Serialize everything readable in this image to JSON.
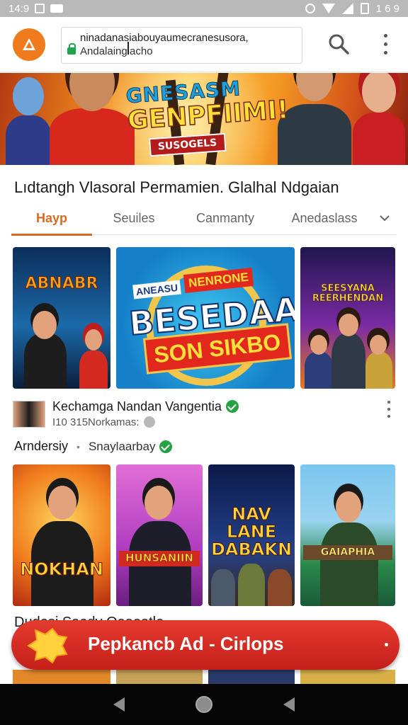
{
  "status_bar": {
    "time": "14:9",
    "right_text": "1 6 9"
  },
  "browser": {
    "url_line1": "ninadanasiabouyaumecranesusora,",
    "url_line2": "Andalaingiacho"
  },
  "banner": {
    "title_top": "GNESASM",
    "title_main": "GENPFIIMI!",
    "badge": "SUSOGELS"
  },
  "channel": {
    "title": "Lıdtangh Vlasoral Permamien. Glalhal Ndgaian"
  },
  "tabs": [
    {
      "label": "Hayp"
    },
    {
      "label": "Seuiles"
    },
    {
      "label": "Canmanty"
    },
    {
      "label": "Anedaslass"
    }
  ],
  "row1": [
    {
      "caption": "ABNABR"
    },
    {
      "caption_small": "ANEASU",
      "caption_badge": "NENRONE",
      "caption_big": "BESEDAAI",
      "caption_strip": "SON SIKBO"
    },
    {
      "caption": "SEESYANA REERHENDAN"
    }
  ],
  "video_meta": {
    "title": "Kechamga Nandan Vangentia",
    "subtitle": "I10 315Norkamas:"
  },
  "section": {
    "name": "Arndersiy",
    "sub": "Snaylaarbay"
  },
  "row2": [
    {
      "caption": "NOKHAN"
    },
    {
      "caption": "HUNSANIIN"
    },
    {
      "caption": "NAV LANE DABAKN"
    },
    {
      "caption": "GAIAPHIA"
    }
  ],
  "partial_row_text": "Dudesi Saedy Oaaoatle",
  "ad": {
    "label": "Pepkancb Ad - Cirlops"
  },
  "colors": {
    "accent": "#f07b1d",
    "tab_active": "#d96a21",
    "ad_red": "#d72c24",
    "verified": "#25a244"
  }
}
